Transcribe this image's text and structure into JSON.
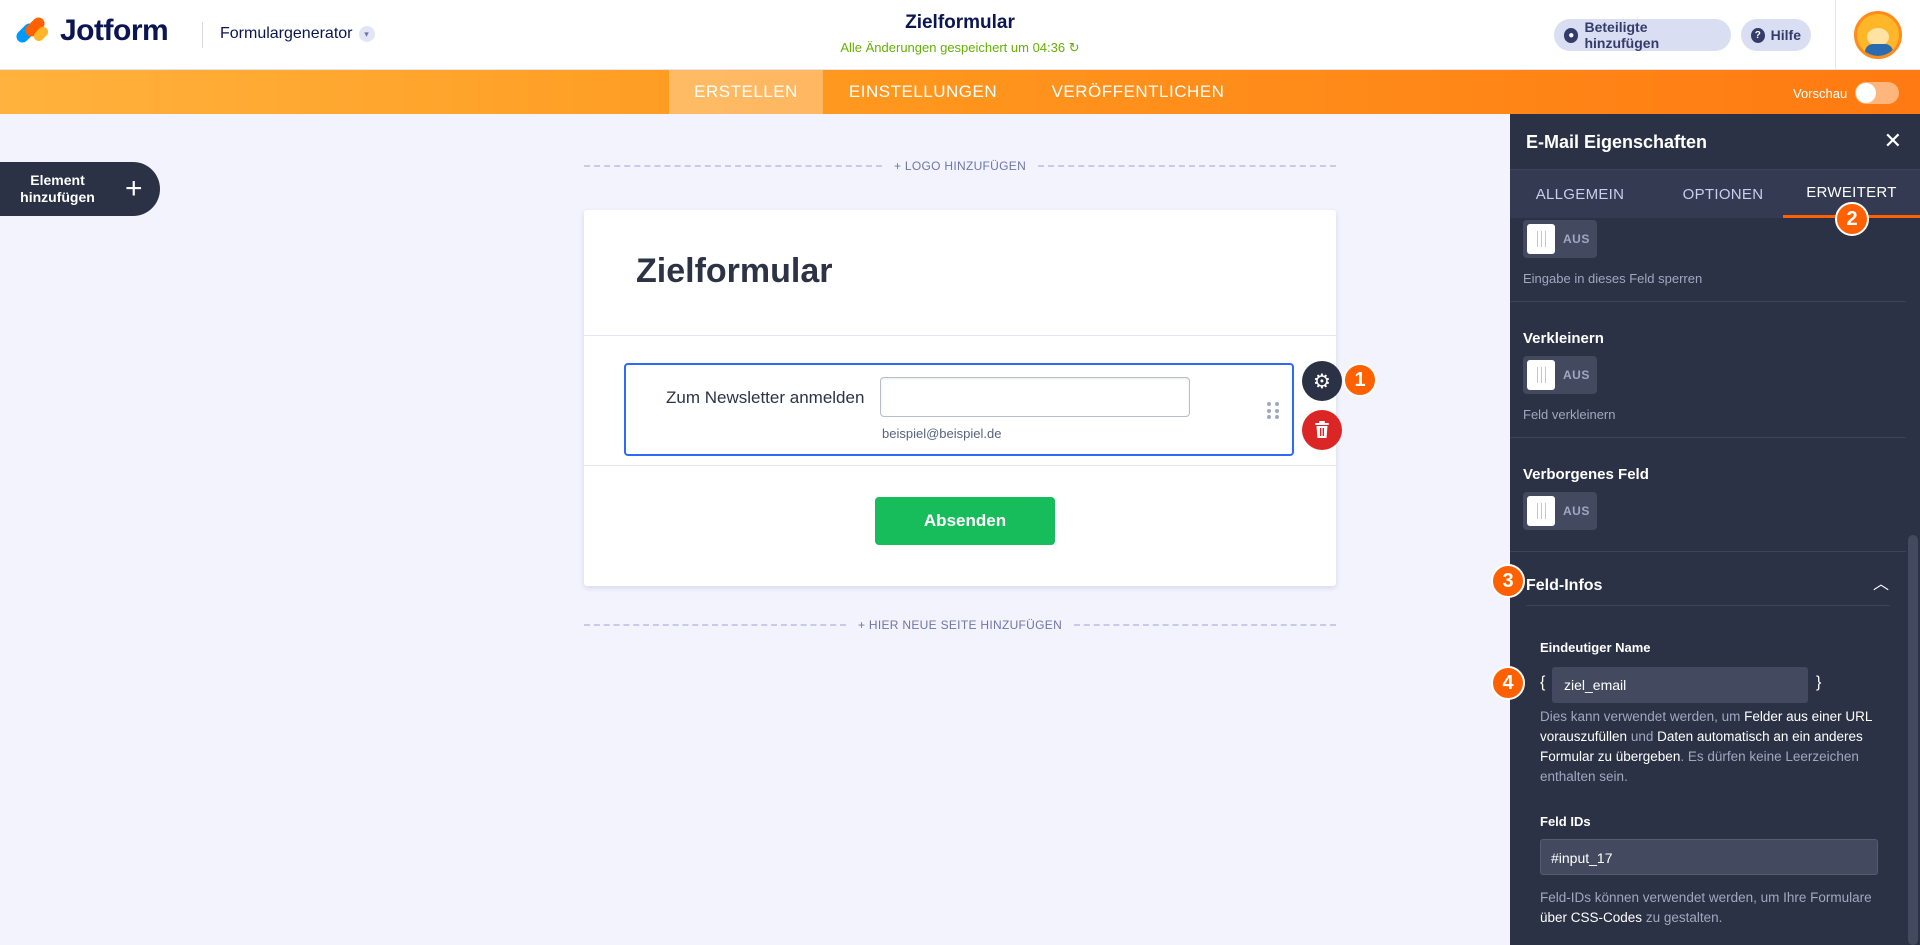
{
  "header": {
    "logo_text": "Jotform",
    "product_label": "Formulargenerator",
    "form_title": "Zielformular",
    "saved_status": "Alle Änderungen gespeichert um 04:36",
    "share_label": "Beteiligte hinzufügen",
    "help_label": "Hilfe"
  },
  "nav": {
    "tabs": [
      {
        "label": "ERSTELLEN",
        "active": true
      },
      {
        "label": "EINSTELLUNGEN",
        "active": false
      },
      {
        "label": "VERÖFFENTLICHEN",
        "active": false
      }
    ],
    "preview_label": "Vorschau"
  },
  "builder": {
    "add_element_label": "Element hinzufügen",
    "add_logo_label": "+ LOGO HINZUFÜGEN",
    "add_page_label": "+ HIER NEUE SEITE HINZUFÜGEN"
  },
  "form": {
    "title": "Zielformular",
    "field_label": "Zum Newsletter anmelden",
    "field_value": "",
    "field_sublabel": "beispiel@beispiel.de",
    "submit_label": "Absenden"
  },
  "annotations": {
    "badge_1": "1",
    "badge_2": "2",
    "badge_3": "3",
    "badge_4": "4"
  },
  "panel": {
    "title": "E-Mail Eigenschaften",
    "tabs": [
      "ALLGEMEIN",
      "OPTIONEN",
      "ERWEITERT"
    ],
    "active_tab": "ERWEITERT",
    "toggles": [
      {
        "label": "",
        "state": "AUS",
        "description": "Eingabe in dieses Feld sperren"
      },
      {
        "label": "Verkleinern",
        "state": "AUS",
        "description": "Feld verkleinern"
      },
      {
        "label": "Verborgenes Feld",
        "state": "AUS",
        "description": ""
      }
    ],
    "section_title": "Feld-Infos",
    "unique_name_label": "Eindeutiger Name",
    "unique_name_value": "ziel_email",
    "brace_open": "{",
    "brace_close": "}",
    "unique_name_help": {
      "p1": "Dies kann verwendet werden, um ",
      "hl1": "Felder aus einer URL vorauszufüllen",
      "p2": " und ",
      "hl2": "Daten automatisch an ein anderes Formular zu übergeben",
      "p3": ". Es dürfen keine Leerzeichen enthalten sein."
    },
    "field_ids_label": "Feld IDs",
    "field_ids_value": "#input_17",
    "field_ids_help": {
      "p1": "Feld-IDs können verwendet werden, um Ihre Formulare ",
      "hl1": "über CSS-Codes",
      "p2": " zu gestalten."
    }
  },
  "colors": {
    "brand_orange": "#ff6100",
    "panel_bg": "#2b3245",
    "submit_green": "#18bd5b",
    "saved_green": "#64b200",
    "selected_blue": "#2e69ff"
  }
}
